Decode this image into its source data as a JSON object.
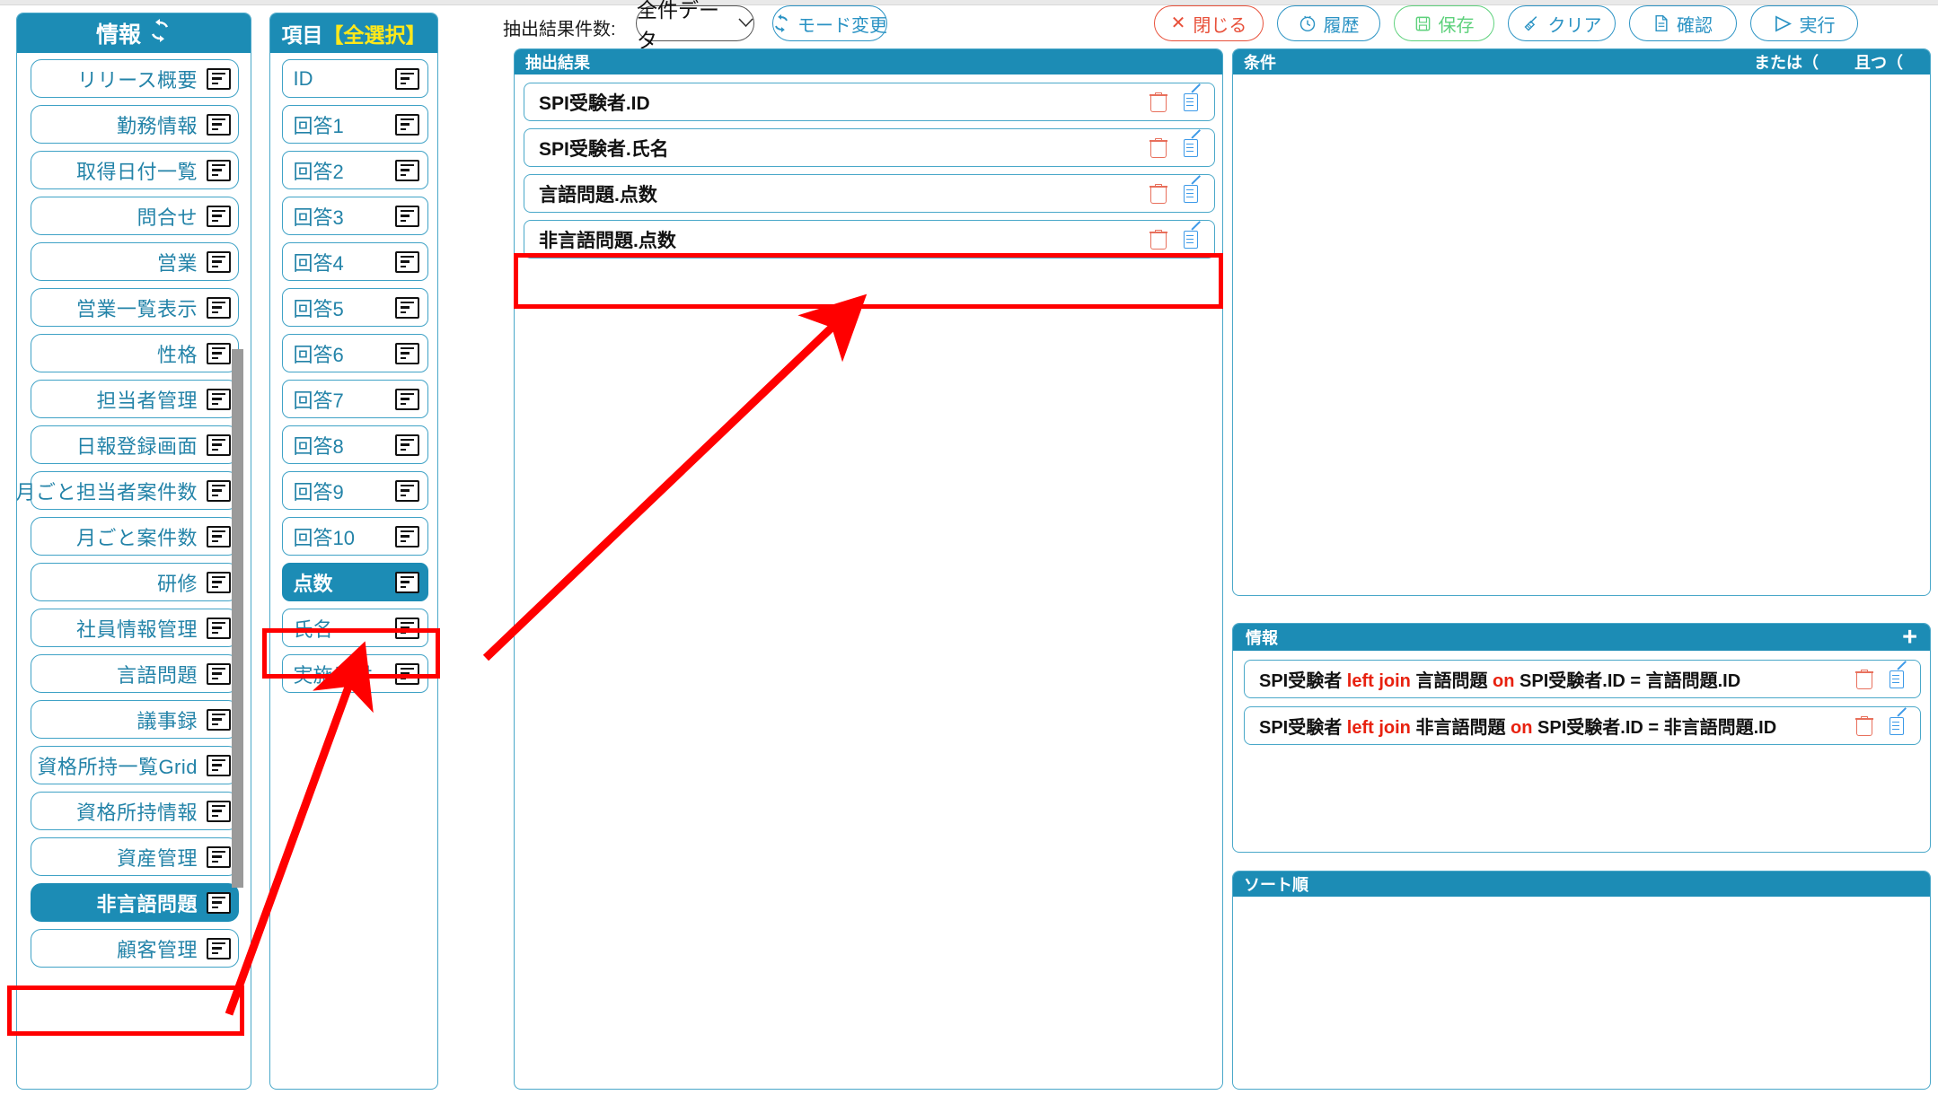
{
  "colors": {
    "header": "#1c8cb5",
    "border": "#4aa8c9",
    "accent_text": "#2383a8",
    "highlight_red": "#ff0000",
    "keyword_red": "#e8210f",
    "yellow": "#ffe81a"
  },
  "sidebar": {
    "title": "情報",
    "refresh_icon": "refresh-icon",
    "items": [
      {
        "label": "リリース概要",
        "selected": false
      },
      {
        "label": "勤務情報",
        "selected": false
      },
      {
        "label": "取得日付一覧",
        "selected": false
      },
      {
        "label": "問合せ",
        "selected": false
      },
      {
        "label": "営業",
        "selected": false
      },
      {
        "label": "営業一覧表示",
        "selected": false
      },
      {
        "label": "性格",
        "selected": false
      },
      {
        "label": "担当者管理",
        "selected": false
      },
      {
        "label": "日報登録画面",
        "selected": false
      },
      {
        "label": "月ごと担当者案件数",
        "selected": false
      },
      {
        "label": "月ごと案件数",
        "selected": false
      },
      {
        "label": "研修",
        "selected": false
      },
      {
        "label": "社員情報管理",
        "selected": false
      },
      {
        "label": "言語問題",
        "selected": false
      },
      {
        "label": "議事録",
        "selected": false
      },
      {
        "label": "資格所持一覧Grid",
        "selected": false
      },
      {
        "label": "資格所持情報",
        "selected": false
      },
      {
        "label": "資産管理",
        "selected": false
      },
      {
        "label": "非言語問題",
        "selected": true
      },
      {
        "label": "顧客管理",
        "selected": false
      }
    ]
  },
  "items_panel": {
    "title_main": "項目",
    "title_highlight": "【全選択】",
    "items": [
      {
        "label": "ID",
        "selected": false
      },
      {
        "label": "回答1",
        "selected": false
      },
      {
        "label": "回答2",
        "selected": false
      },
      {
        "label": "回答3",
        "selected": false
      },
      {
        "label": "回答4",
        "selected": false
      },
      {
        "label": "回答5",
        "selected": false
      },
      {
        "label": "回答6",
        "selected": false
      },
      {
        "label": "回答7",
        "selected": false
      },
      {
        "label": "回答8",
        "selected": false
      },
      {
        "label": "回答9",
        "selected": false
      },
      {
        "label": "回答10",
        "selected": false
      },
      {
        "label": "点数",
        "selected": true
      },
      {
        "label": "氏名",
        "selected": false
      },
      {
        "label": "実施日付",
        "selected": false
      }
    ]
  },
  "toolbar": {
    "count_label": "抽出結果件数:",
    "count_select_value": "全件データ",
    "count_select_chevron": "⌄",
    "mode_button": "モード変更",
    "close_button": "閉じる",
    "history_button": "履歴",
    "save_button": "保存",
    "clear_button": "クリア",
    "confirm_button": "確認",
    "run_button": "実行",
    "close_icon": "✕",
    "history_icon": "clock-icon",
    "save_icon": "floppy-icon",
    "clear_icon": "broom-icon",
    "confirm_icon": "document-icon",
    "run_icon": "▶"
  },
  "extract_panel": {
    "title": "抽出結果",
    "rows": [
      {
        "text": "SPI受験者.ID",
        "highlighted": false
      },
      {
        "text": "SPI受験者.氏名",
        "highlighted": false
      },
      {
        "text": "言語問題.点数",
        "highlighted": false
      },
      {
        "text": "非言語問題.点数",
        "highlighted": true
      }
    ]
  },
  "condition_panel": {
    "title": "条件",
    "col_or": "または（",
    "col_and": "且つ（",
    "rows": []
  },
  "info_panel": {
    "title": "情報",
    "add_icon": "+",
    "rows": [
      {
        "left_table": "SPI受験者",
        "join": "left join",
        "right_table": "言語問題",
        "on": "on",
        "expr": "SPI受験者.ID = 言語問題.ID"
      },
      {
        "left_table": "SPI受験者",
        "join": "left join",
        "right_table": "非言語問題",
        "on": "on",
        "expr": "SPI受験者.ID = 非言語問題.ID"
      }
    ]
  },
  "sort_panel": {
    "title": "ソート順",
    "rows": []
  },
  "annotations": {
    "highlight_sidebar_item": "非言語問題",
    "highlight_item": "点数",
    "highlight_extract_row": "非言語問題.点数",
    "arrow_count": 2
  }
}
